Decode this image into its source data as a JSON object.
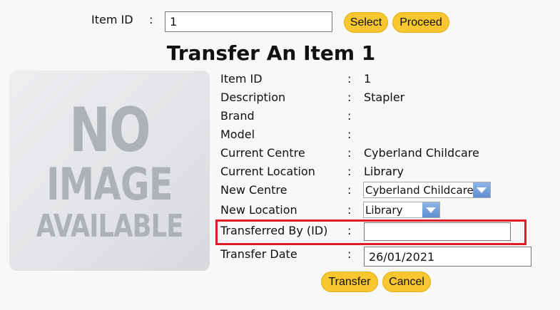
{
  "search": {
    "label": "Item ID",
    "colon": ":",
    "value": "1",
    "select_label": "Select",
    "proceed_label": "Proceed"
  },
  "page": {
    "title": "Transfer An Item 1"
  },
  "image": {
    "line1": "NO",
    "line2": "IMAGE",
    "line3": "AVAILABLE"
  },
  "details": {
    "colon": ":",
    "item_id": {
      "label": "Item ID",
      "value": "1"
    },
    "description": {
      "label": "Description",
      "value": "Stapler"
    },
    "brand": {
      "label": "Brand",
      "value": ""
    },
    "model": {
      "label": "Model",
      "value": ""
    },
    "current_centre": {
      "label": "Current Centre",
      "value": "Cyberland Childcare"
    },
    "current_location": {
      "label": "Current Location",
      "value": "Library"
    }
  },
  "form": {
    "new_centre": {
      "label": "New Centre",
      "selected": "Cyberland Childcare"
    },
    "new_location": {
      "label": "New Location",
      "selected": "Library"
    },
    "transferred_by": {
      "label": "Transferred By (ID)",
      "value": ""
    },
    "transfer_date": {
      "label": "Transfer Date",
      "value": "26/01/2021"
    }
  },
  "actions": {
    "transfer_label": "Transfer",
    "cancel_label": "Cancel"
  },
  "colors": {
    "button": "#f8c62e",
    "highlight": "#e11c24",
    "dropdown_arrow": "#6b9bdc"
  }
}
